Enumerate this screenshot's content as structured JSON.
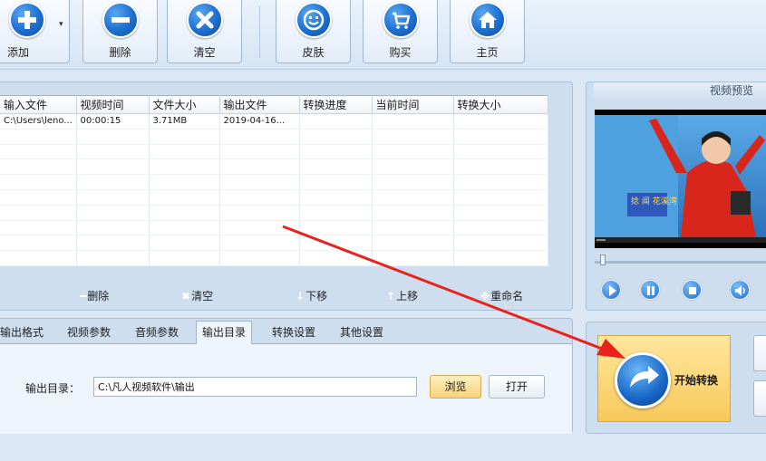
{
  "toolbar": {
    "add_label": "添加",
    "delete_label": "删除",
    "clear_label": "清空",
    "skin_label": "皮肤",
    "buy_label": "购买",
    "home_label": "主页",
    "dropdown_glyph": "▾"
  },
  "file_list": {
    "columns": [
      "输入文件",
      "视频时间",
      "文件大小",
      "输出文件",
      "转换进度",
      "当前时间",
      "转换大小"
    ],
    "rows": [
      [
        "C:\\Users\\leno...",
        "00:00:15",
        "3.71MB",
        "2019-04-16...",
        "",
        "",
        ""
      ]
    ],
    "actions": {
      "delete": "删除",
      "clear": "清空",
      "move_down": "下移",
      "move_up": "上移",
      "rename": "重命名"
    }
  },
  "preview": {
    "title": "视频预览",
    "video_overlay_text": "捻 闻 花溪湾"
  },
  "settings": {
    "tabs": [
      "输出格式",
      "视频参数",
      "音频参数",
      "输出目录",
      "转换设置",
      "其他设置"
    ],
    "active_tab": "输出目录",
    "output_dir_label": "输出目录：",
    "output_dir_value": "C:\\凡人视频软件\\输出",
    "browse_label": "浏览",
    "open_label": "打开"
  },
  "start": {
    "label": "开始转换"
  },
  "colors": {
    "accent_blue": "#1c6fd1",
    "start_button": "#f7c95a",
    "annotation_arrow": "#e8231b"
  }
}
